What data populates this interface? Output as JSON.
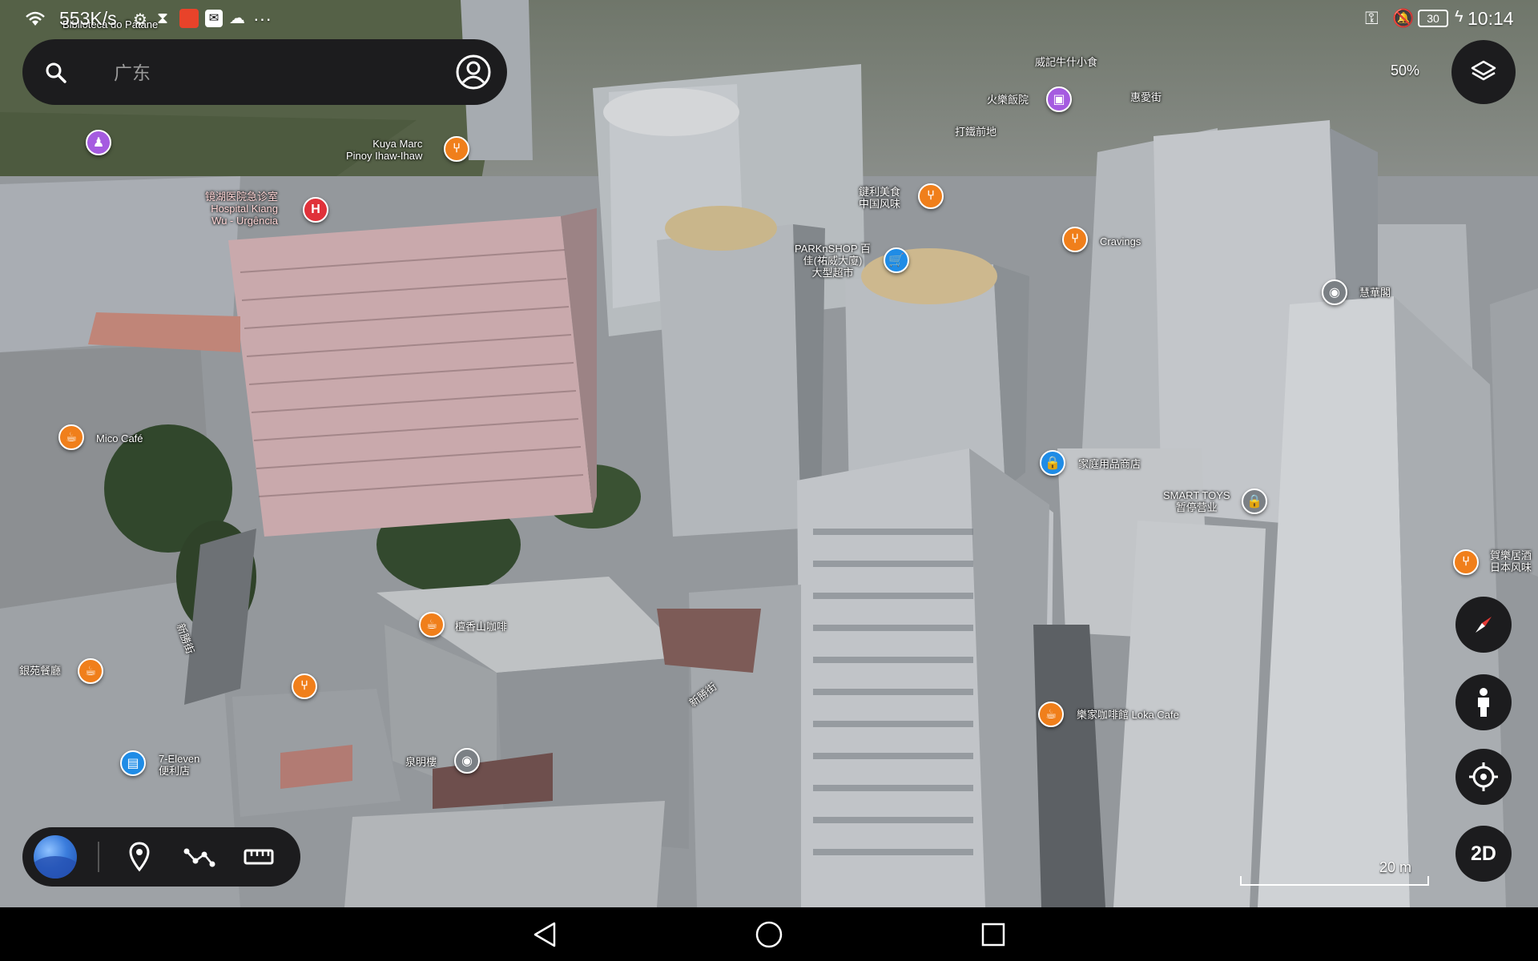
{
  "status_bar": {
    "network_speed": "553K/s",
    "battery": "30",
    "time": "10:14",
    "more": "···"
  },
  "search": {
    "placeholder": "广东"
  },
  "layers": {
    "zoom_percent": "50%"
  },
  "controls": {
    "view_mode_label": "2D"
  },
  "scale": {
    "label": "20 m"
  },
  "map_labels": {
    "top_left_poi": "Biblioteca do Patane",
    "kuya": "Kuya Marc\nPinoy Ihaw-Ihaw",
    "hospital": "镜湖医院急诊室\nHospital Kiang\nWu - Urgência",
    "mico": "Mico Café",
    "weiji": "威記牛什小食",
    "huoguo": "火樂飯院",
    "yuanai": "惠愛街",
    "dajie": "打鐵前地",
    "jianli": "鍵利美食\n中国风味",
    "parknshop": "PARKnSHOP 百\n佳(祐威大廈)\n大型超市",
    "cravings": "Cravings",
    "huihua": "慧華閣",
    "jiating": "家庭用品商店",
    "smarttoys": "SMART TOYS\n暂停营业",
    "liu_restaurant": "賀樂居酒\n日本风味",
    "tanxiang": "檀香山咖啡",
    "yinyuan": "銀苑餐廳",
    "xinsheng": "新勝街",
    "xinsheng2": "新勝街",
    "seven": "7-Eleven\n便利店",
    "quanming": "泉明樓",
    "loka": "樂家咖啡館 Loka Cafe"
  },
  "colors": {
    "panel": "#1c1c1e",
    "poi_food": "#f07f1b",
    "poi_shop": "#1f8ce6",
    "poi_hospital": "#e0323a",
    "poi_culture": "#a55be0"
  },
  "icons": [
    "wifi-icon",
    "search-icon",
    "account-icon",
    "layers-icon",
    "compass-icon",
    "pegman-icon",
    "my-location-icon",
    "earth-logo-icon",
    "place-pin-icon",
    "draw-path-icon",
    "ruler-icon",
    "back-icon",
    "home-icon",
    "recents-icon"
  ]
}
